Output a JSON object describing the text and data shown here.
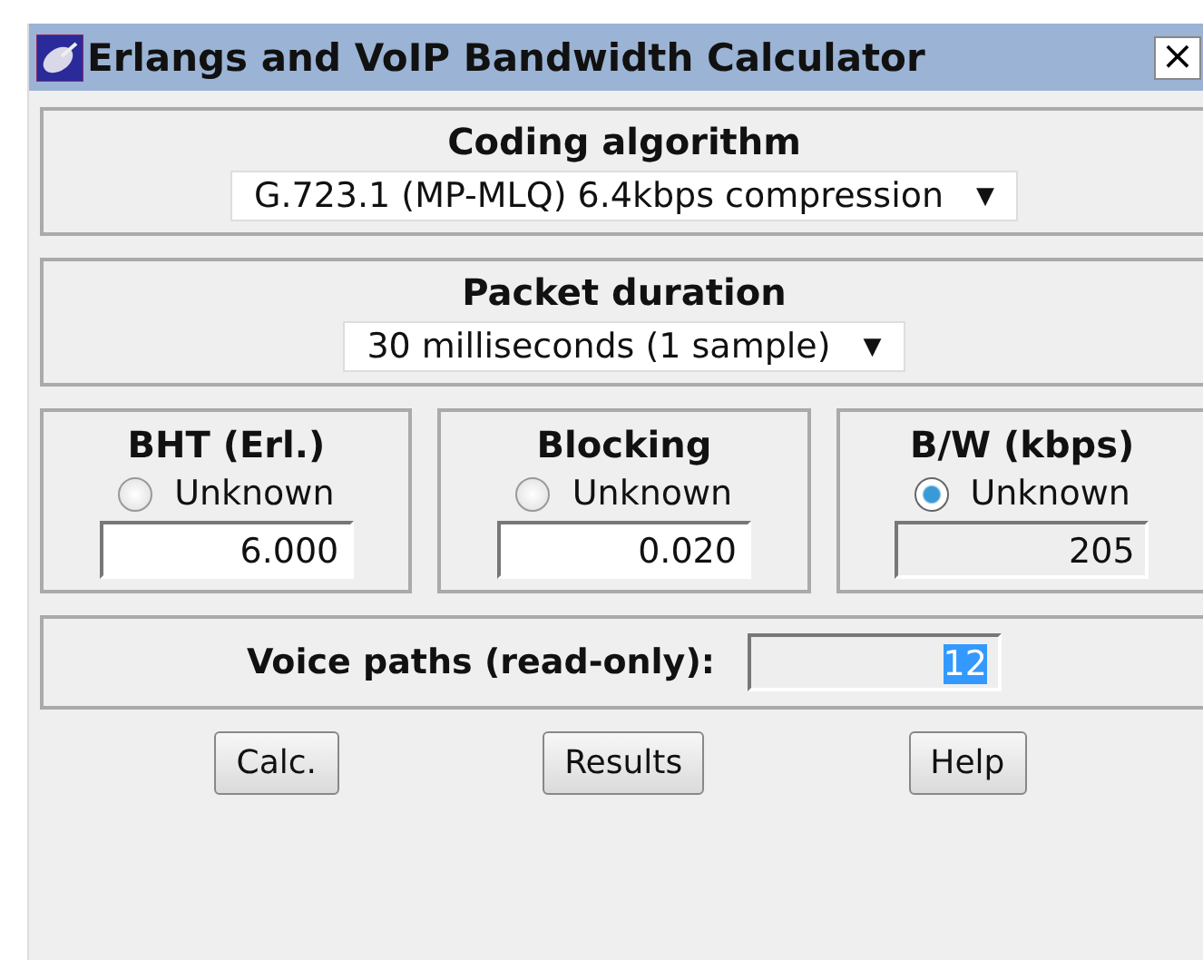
{
  "window": {
    "title": "Erlangs and VoIP Bandwidth Calculator",
    "close": "×"
  },
  "coding": {
    "label": "Coding algorithm",
    "value": "G.723.1 (MP-MLQ) 6.4kbps compression",
    "arrow": "▼"
  },
  "packet": {
    "label": "Packet duration",
    "value": "30 milliseconds (1 sample)",
    "arrow": "▼"
  },
  "params": [
    {
      "label": "BHT (Erl.)",
      "option": "Unknown",
      "selected": false,
      "value": "6.000",
      "readonly": false
    },
    {
      "label": "Blocking",
      "option": "Unknown",
      "selected": false,
      "value": "0.020",
      "readonly": false
    },
    {
      "label": "B/W (kbps)",
      "option": "Unknown",
      "selected": true,
      "value": "205",
      "readonly": true
    }
  ],
  "voice_paths": {
    "label": "Voice paths (read-only):",
    "value": "12",
    "highlighted": true
  },
  "buttons": [
    "Calc.",
    "Results",
    "Help"
  ]
}
